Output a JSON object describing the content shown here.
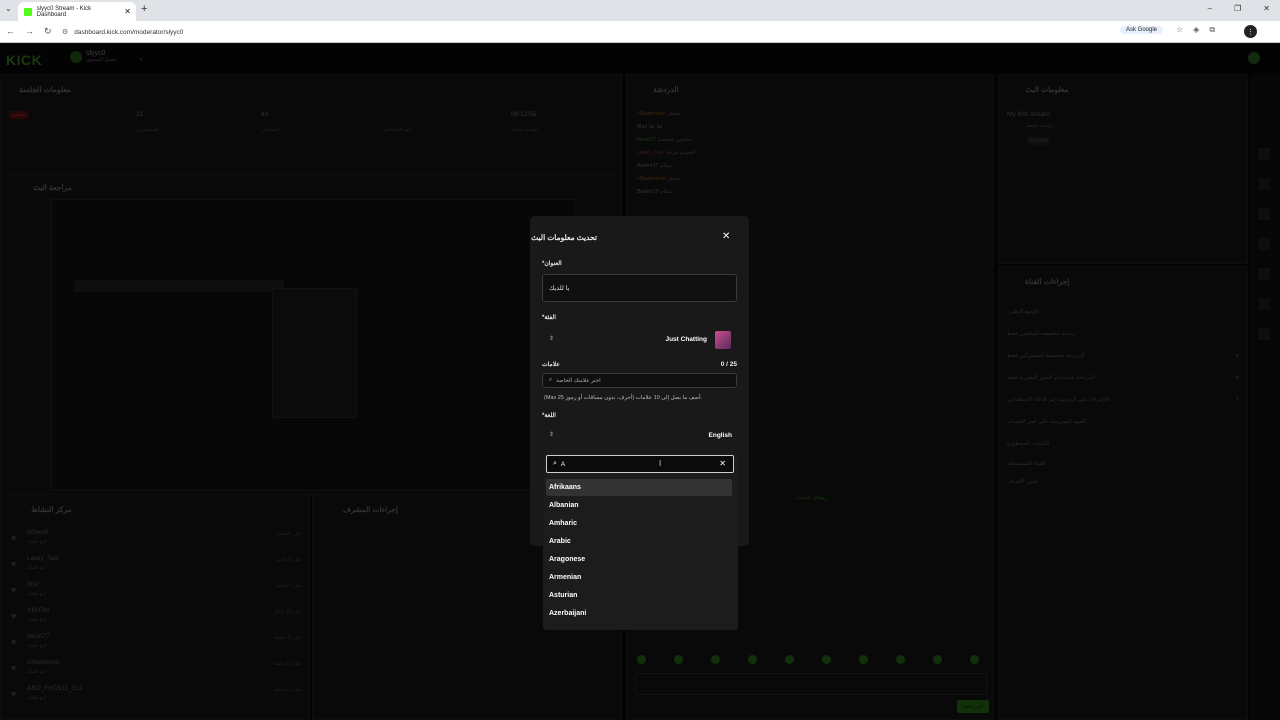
{
  "browser": {
    "tab_title": "slyyc0 Stream - Kick Dashboard",
    "url": "dashboard.kick.com/moderator/slyyc0",
    "ask_google": "Ask Google"
  },
  "app": {
    "logo": "KICK",
    "channel_name": "slyyc0",
    "channel_sub": "تعديل المحتوى"
  },
  "session": {
    "title": "معلومات الجلسة",
    "live_badge": "مباشر",
    "stats": [
      {
        "value": "06:12:55",
        "label": "الوقت مباشر"
      },
      {
        "value": "-",
        "label": "عدد الأشخاص"
      },
      {
        "value": "43",
        "label": "المتابعين"
      },
      {
        "value": "21",
        "label": "المشاهدين"
      }
    ]
  },
  "preview": {
    "title": "مراجعة البث"
  },
  "activity": {
    "title": "مركز النشاط",
    "rows": [
      {
        "user": "00bxo0",
        "desc": "تابع القناة",
        "time": "قبل دقيقتين"
      },
      {
        "user": "Lawly_Taix",
        "desc": "تابع القناة",
        "time": "قبل 5 دقائق"
      },
      {
        "user": "8hiz",
        "desc": "تابع القناة",
        "time": "قبل 8 دقائق"
      },
      {
        "user": "YBH7hi",
        "desc": "تابع القناة",
        "time": "قبل 10 دقائق"
      },
      {
        "user": "leesh77",
        "desc": "تابع القناة",
        "time": "قبل 11 دقيقة"
      },
      {
        "user": "xShamrock",
        "desc": "تابع القناة",
        "time": "قبل 12 دقيقة"
      },
      {
        "user": "ABO_FHD511_S11",
        "desc": "تابع القناة",
        "time": "قبل 13 دقيقة"
      }
    ]
  },
  "mod_actions": {
    "title": "إجراءات المشرف"
  },
  "chat": {
    "title": "الدردشة",
    "messages": [
      {
        "user": "xShamrocki",
        "text": "يحظر"
      },
      {
        "user": "8hiz",
        "text": "هلا هلا"
      },
      {
        "user": "leesh77",
        "text": "متابعين شخصيا"
      },
      {
        "user": "Lawly_Taix",
        "text": "الجسم مرحبا"
      },
      {
        "user": "Bashir17",
        "text": "سلام"
      },
      {
        "user": "xShamrocki",
        "text": "يحظر"
      },
      {
        "user": "Bashir17",
        "text": "سلام"
      }
    ],
    "welcome_label": "رسائل جديدة",
    "send_label": "الدردشة"
  },
  "stream_info": {
    "title": "معلومات البث",
    "stream_title": "My first stream.",
    "category": "دردشة فقط",
    "language": "English"
  },
  "channel_actions": {
    "title": "إجراءات القناة",
    "items": [
      "الوضع البطيء",
      "دردشة مخصصة للمتابعين فقط",
      "الدردشة مخصصة للمشتركين فقط",
      "الدردشة باستخدام الصور التعبيرية فقط",
      "الاعتراف على الدردشة عبر الذكاء الاصطناعي",
      "القيود المفروضة على عمر الحساب",
      "الكلمات المحظورة",
      "القناة المستضافة",
      "تعيين الأهداف"
    ]
  },
  "modal": {
    "title": "تحديث معلومات البث",
    "title_label": "*العنوان",
    "title_value": "يا للديك",
    "category_label": "*الفئة",
    "category_value": "Just Chatting",
    "tags_label": "علامات",
    "tags_count": "0 / 25",
    "tags_placeholder": "اختر علامتك الخاصة",
    "tags_hint": "(Max 25 أحرف، بدون مسافات أو رموز) أضف ما يصل إلى 10 علامات.",
    "language_label": "*اللغة",
    "language_value": "English"
  },
  "language_dropdown": {
    "search_value": "A",
    "options": [
      "Afrikaans",
      "Albanian",
      "Amharic",
      "Arabic",
      "Aragonese",
      "Armenian",
      "Asturian",
      "Azerbaijani"
    ],
    "highlighted_index": 0
  }
}
